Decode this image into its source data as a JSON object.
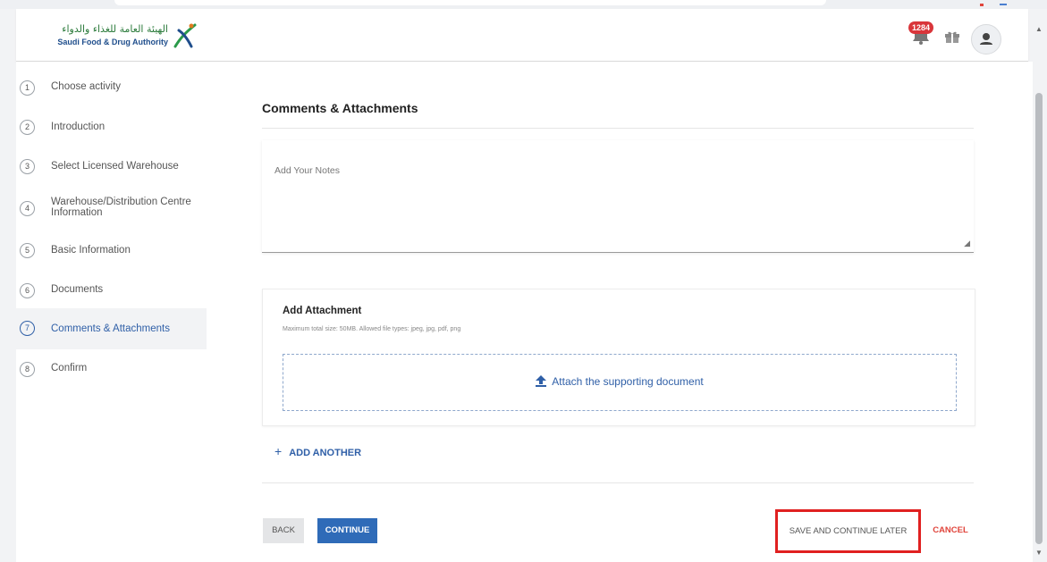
{
  "header": {
    "logo_ar": "الهيئة العامة للغذاء والدواء",
    "logo_en": "Saudi Food & Drug Authority",
    "notification_count": "1284"
  },
  "sidebar": {
    "steps": [
      {
        "num": "1",
        "label": "Choose activity"
      },
      {
        "num": "2",
        "label": "Introduction"
      },
      {
        "num": "3",
        "label": "Select Licensed Warehouse"
      },
      {
        "num": "4",
        "label": "Warehouse/Distribution Centre",
        "label2": "Information"
      },
      {
        "num": "5",
        "label": "Basic Information"
      },
      {
        "num": "6",
        "label": "Documents"
      },
      {
        "num": "7",
        "label": "Comments & Attachments"
      },
      {
        "num": "8",
        "label": "Confirm"
      }
    ]
  },
  "main": {
    "title": "Comments & Attachments",
    "notes_placeholder": "Add Your Notes",
    "attachment": {
      "heading": "Add Attachment",
      "hint": "Maximum total size: 50MB. Allowed file types: jpeg, jpg, pdf, png",
      "drop_label": "Attach the supporting document"
    },
    "add_another": "ADD ANOTHER"
  },
  "actions": {
    "back": "BACK",
    "continue": "CONTINUE",
    "save_later": "SAVE AND CONTINUE LATER",
    "cancel": "CANCEL"
  },
  "colors": {
    "primary": "#2f6bb8",
    "link": "#2f5fa7",
    "cancel": "#e0443b",
    "highlight": "#e02020",
    "badge": "#d9353a"
  },
  "icons": [
    "bell-icon",
    "gift-icon",
    "user-icon",
    "upload-icon",
    "plus-icon",
    "resize-grip-icon",
    "scroll-up-icon",
    "scroll-down-icon"
  ]
}
